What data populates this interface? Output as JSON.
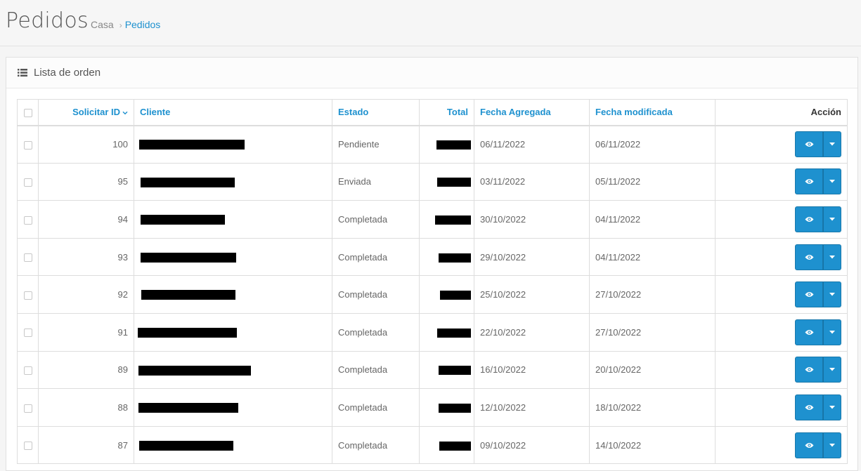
{
  "header": {
    "title": "Pedidos",
    "breadcrumb": {
      "home": "Casa",
      "separator": "›",
      "current": "Pedidos"
    }
  },
  "panel": {
    "title": "Lista de orden",
    "icon": "list-icon"
  },
  "table": {
    "columns": {
      "order_id": "Solicitar ID",
      "customer": "Cliente",
      "status": "Estado",
      "total": "Total",
      "date_added": "Fecha Agregada",
      "date_modified": "Fecha modificada",
      "action": "Acción"
    },
    "sort_icon": "chevron-down-icon",
    "rows": [
      {
        "id": "100",
        "status": "Pendiente",
        "date_added": "06/11/2022",
        "date_modified": "06/11/2022"
      },
      {
        "id": "95",
        "status": "Enviada",
        "date_added": "03/11/2022",
        "date_modified": "05/11/2022"
      },
      {
        "id": "94",
        "status": "Completada",
        "date_added": "30/10/2022",
        "date_modified": "04/11/2022"
      },
      {
        "id": "93",
        "status": "Completada",
        "date_added": "29/10/2022",
        "date_modified": "04/11/2022"
      },
      {
        "id": "92",
        "status": "Completada",
        "date_added": "25/10/2022",
        "date_modified": "27/10/2022"
      },
      {
        "id": "91",
        "status": "Completada",
        "date_added": "22/10/2022",
        "date_modified": "27/10/2022"
      },
      {
        "id": "89",
        "status": "Completada",
        "date_added": "16/10/2022",
        "date_modified": "20/10/2022"
      },
      {
        "id": "88",
        "status": "Completada",
        "date_added": "12/10/2022",
        "date_modified": "18/10/2022"
      },
      {
        "id": "87",
        "status": "Completada",
        "date_added": "09/10/2022",
        "date_modified": "14/10/2022"
      }
    ]
  },
  "colors": {
    "accent": "#1e91cf",
    "redaction": "#000000"
  }
}
